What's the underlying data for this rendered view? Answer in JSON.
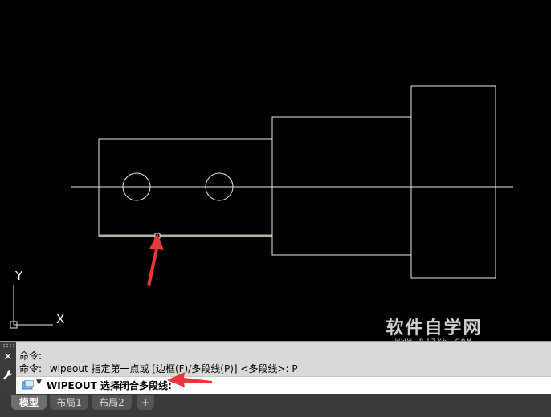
{
  "axes": {
    "y_label": "Y",
    "x_label": "X"
  },
  "watermark": {
    "main": "软件自学网",
    "sub": "WWW.RJZXW.COM"
  },
  "command": {
    "history": [
      "命令:",
      "命令: _wipeout 指定第一点或 [边框(F)/多段线(P)] <多段线>: P"
    ],
    "prompt": "WIPEOUT 选择闭合多段线:"
  },
  "tabs": [
    {
      "label": "模型",
      "active": true
    },
    {
      "label": "布局1",
      "active": false
    },
    {
      "label": "布局2",
      "active": false
    }
  ],
  "add_tab_label": "+",
  "colors": {
    "background": "#000000",
    "lines": "#ffffff",
    "annotation_arrow": "#e8383b"
  },
  "icons": [
    "close-icon",
    "wrench-icon",
    "command-prompt-icon",
    "chevron-down-icon",
    "plus-icon"
  ]
}
